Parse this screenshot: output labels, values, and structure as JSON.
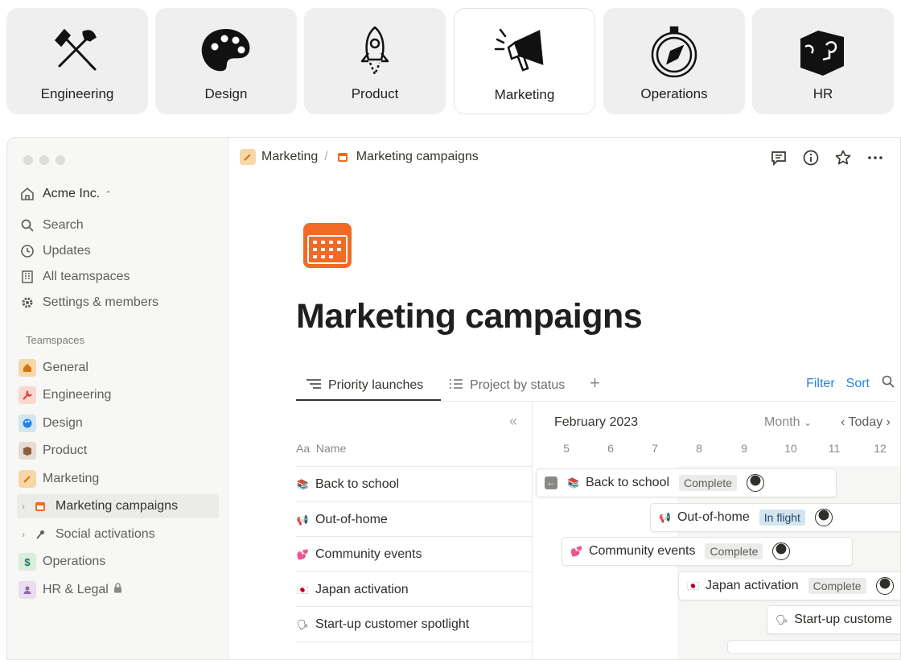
{
  "tiles": [
    {
      "label": "Engineering",
      "icon": "tools-icon"
    },
    {
      "label": "Design",
      "icon": "palette-icon"
    },
    {
      "label": "Product",
      "icon": "rocket-icon"
    },
    {
      "label": "Marketing",
      "icon": "megaphone-icon",
      "active": true
    },
    {
      "label": "Operations",
      "icon": "compass-icon"
    },
    {
      "label": "HR",
      "icon": "puzzle-icon"
    }
  ],
  "sidebar": {
    "workspace": "Acme Inc.",
    "nav": [
      {
        "label": "Search",
        "icon": "search-icon"
      },
      {
        "label": "Updates",
        "icon": "clock-icon"
      },
      {
        "label": "All teamspaces",
        "icon": "building-icon"
      },
      {
        "label": "Settings & members",
        "icon": "gear-icon"
      }
    ],
    "teamspaces_heading": "Teamspaces",
    "teamspaces": [
      {
        "label": "General",
        "icon": "house-icon",
        "color": "#f6d7a7"
      },
      {
        "label": "Engineering",
        "icon": "wrench-icon",
        "color": "#fbd7d2"
      },
      {
        "label": "Design",
        "icon": "palette-icon",
        "color": "#d3e5ef"
      },
      {
        "label": "Product",
        "icon": "box-icon",
        "color": "#e6dcd5"
      },
      {
        "label": "Marketing",
        "icon": "pen-icon",
        "color": "#f6d7a7"
      },
      {
        "label": "Marketing campaigns",
        "icon": "calendar-icon",
        "selected": true
      },
      {
        "label": "Social activations",
        "icon": "microphone-icon"
      },
      {
        "label": "Operations",
        "icon": "dollar-icon",
        "color": "#dbeddb"
      },
      {
        "label": "HR & Legal",
        "icon": "person-icon",
        "color": "#e8deee"
      }
    ]
  },
  "breadcrumb": {
    "parent": "Marketing",
    "separator": "/",
    "current": "Marketing campaigns"
  },
  "page": {
    "title": "Marketing campaigns",
    "accent": "#f16a26"
  },
  "tabs": [
    {
      "label": "Priority launches",
      "active": true
    },
    {
      "label": "Project by status"
    }
  ],
  "toolbar": {
    "filter": "Filter",
    "sort": "Sort"
  },
  "table": {
    "name_prefix": "Aa",
    "name_header": "Name",
    "rows": [
      "Back to school",
      "Out-of-home",
      "Community events",
      "Japan activation",
      "Start-up customer spotlight"
    ]
  },
  "timeline": {
    "month": "February 2023",
    "scale": "Month",
    "today": "Today",
    "days": [
      "5",
      "6",
      "7",
      "8",
      "9",
      "10",
      "11",
      "12"
    ],
    "items": [
      {
        "name": "Back to school",
        "status": "Complete"
      },
      {
        "name": "Out-of-home",
        "status": "In flight"
      },
      {
        "name": "Community events",
        "status": "Complete"
      },
      {
        "name": "Japan activation",
        "status": "Complete"
      },
      {
        "name": "Start-up custome"
      }
    ]
  }
}
